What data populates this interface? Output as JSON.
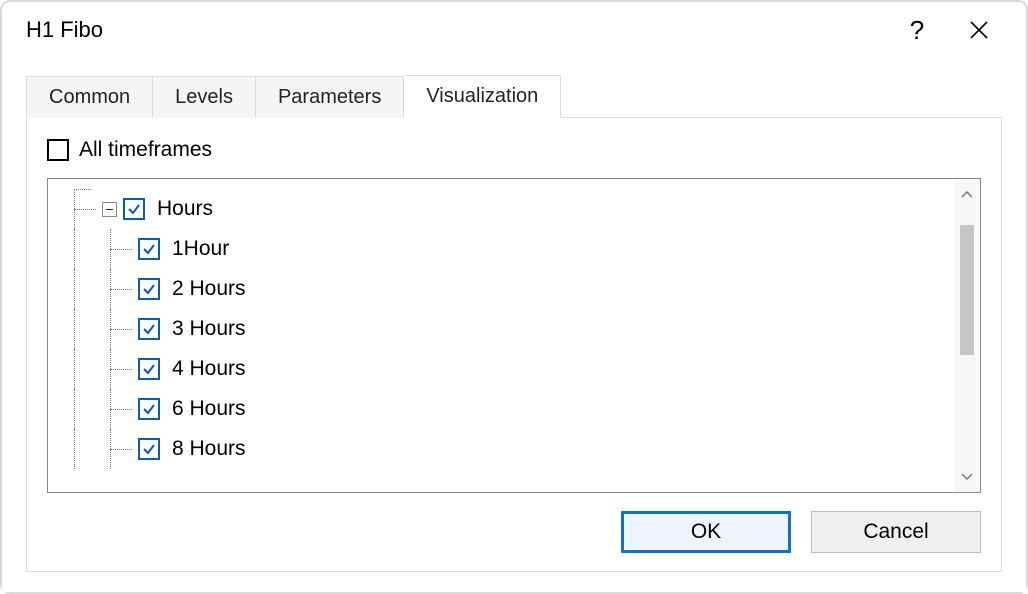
{
  "title": "H1 Fibo",
  "tabs": {
    "common": "Common",
    "levels": "Levels",
    "parameters": "Parameters",
    "visualization": "Visualization"
  },
  "allTimeframes": "All timeframes",
  "tree": {
    "parent": "Hours",
    "children": [
      "1Hour",
      "2 Hours",
      "3 Hours",
      "4 Hours",
      "6 Hours",
      "8 Hours"
    ]
  },
  "buttons": {
    "ok": "OK",
    "cancel": "Cancel"
  }
}
